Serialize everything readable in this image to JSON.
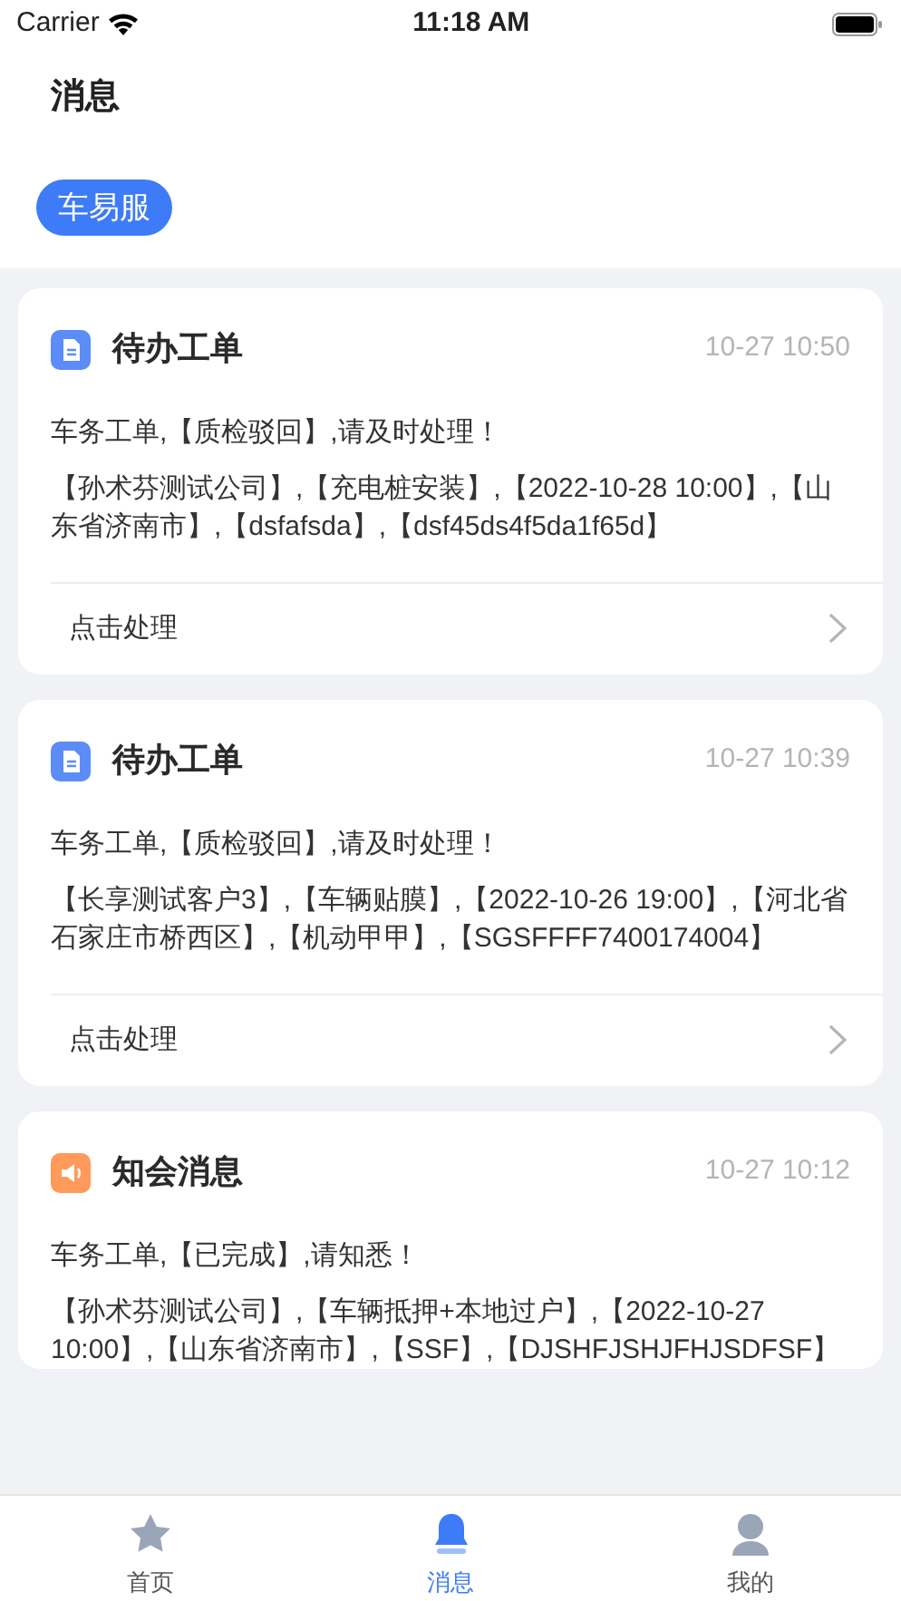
{
  "status_bar": {
    "carrier": "Carrier",
    "time": "11:18 AM"
  },
  "header": {
    "title": "消息"
  },
  "filters": [
    {
      "label": "车易服",
      "selected": true
    }
  ],
  "messages": [
    {
      "kind": "todo",
      "title": "待办工单",
      "time": "10-27 10:50",
      "summary": "车务工单,【质检驳回】,请及时处理！",
      "detail": "【孙术芬测试公司】,【充电桩安装】,【2022-10-28 10:00】,【山东省济南市】,【dsfafsda】,【dsf45ds4f5da1f65d】",
      "action": "点击处理"
    },
    {
      "kind": "todo",
      "title": "待办工单",
      "time": "10-27 10:39",
      "summary": "车务工单,【质检驳回】,请及时处理！",
      "detail": "【长享测试客户3】,【车辆贴膜】,【2022-10-26 19:00】,【河北省石家庄市桥西区】,【机动甲甲】,【SGSFFFF7400174004】",
      "action": "点击处理"
    },
    {
      "kind": "notice",
      "title": "知会消息",
      "time": "10-27 10:12",
      "summary": "车务工单,【已完成】,请知悉！",
      "detail": "【孙术芬测试公司】,【车辆抵押+本地过户】,【2022-10-27 10:00】,【山东省济南市】,【SSF】,【DJSHFJSHJFHJSDFSF】"
    }
  ],
  "tab_bar": [
    {
      "kind": "home",
      "label": "首页",
      "selected": false
    },
    {
      "kind": "bell",
      "label": "消息",
      "selected": true
    },
    {
      "kind": "user",
      "label": "我的",
      "selected": false
    }
  ]
}
